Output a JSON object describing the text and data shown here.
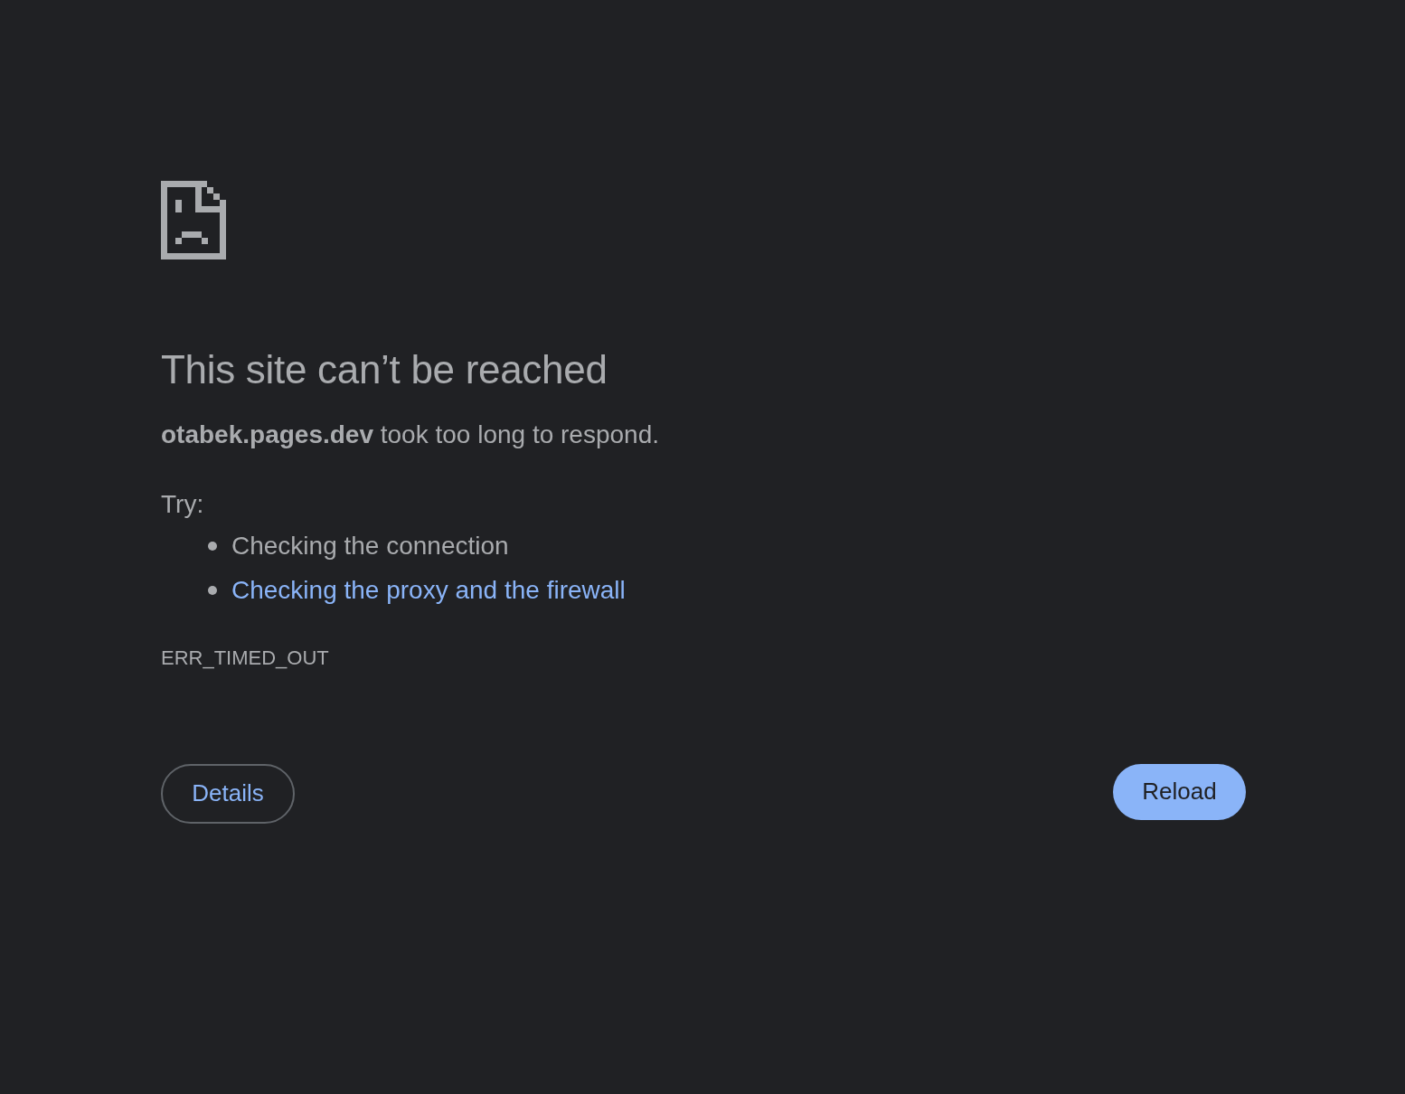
{
  "title": "This site can’t be reached",
  "message": "**otabek.pages.dev** took too long to respond.",
  "try_label": "Try:",
  "suggestions": [
    {
      "text": "Checking the connection",
      "kind": "text"
    },
    {
      "text": "Checking the proxy and the firewall",
      "kind": "link"
    }
  ],
  "error_code": "ERR_TIMED_OUT",
  "buttons": {
    "details": "Details",
    "reload": "Reload"
  }
}
